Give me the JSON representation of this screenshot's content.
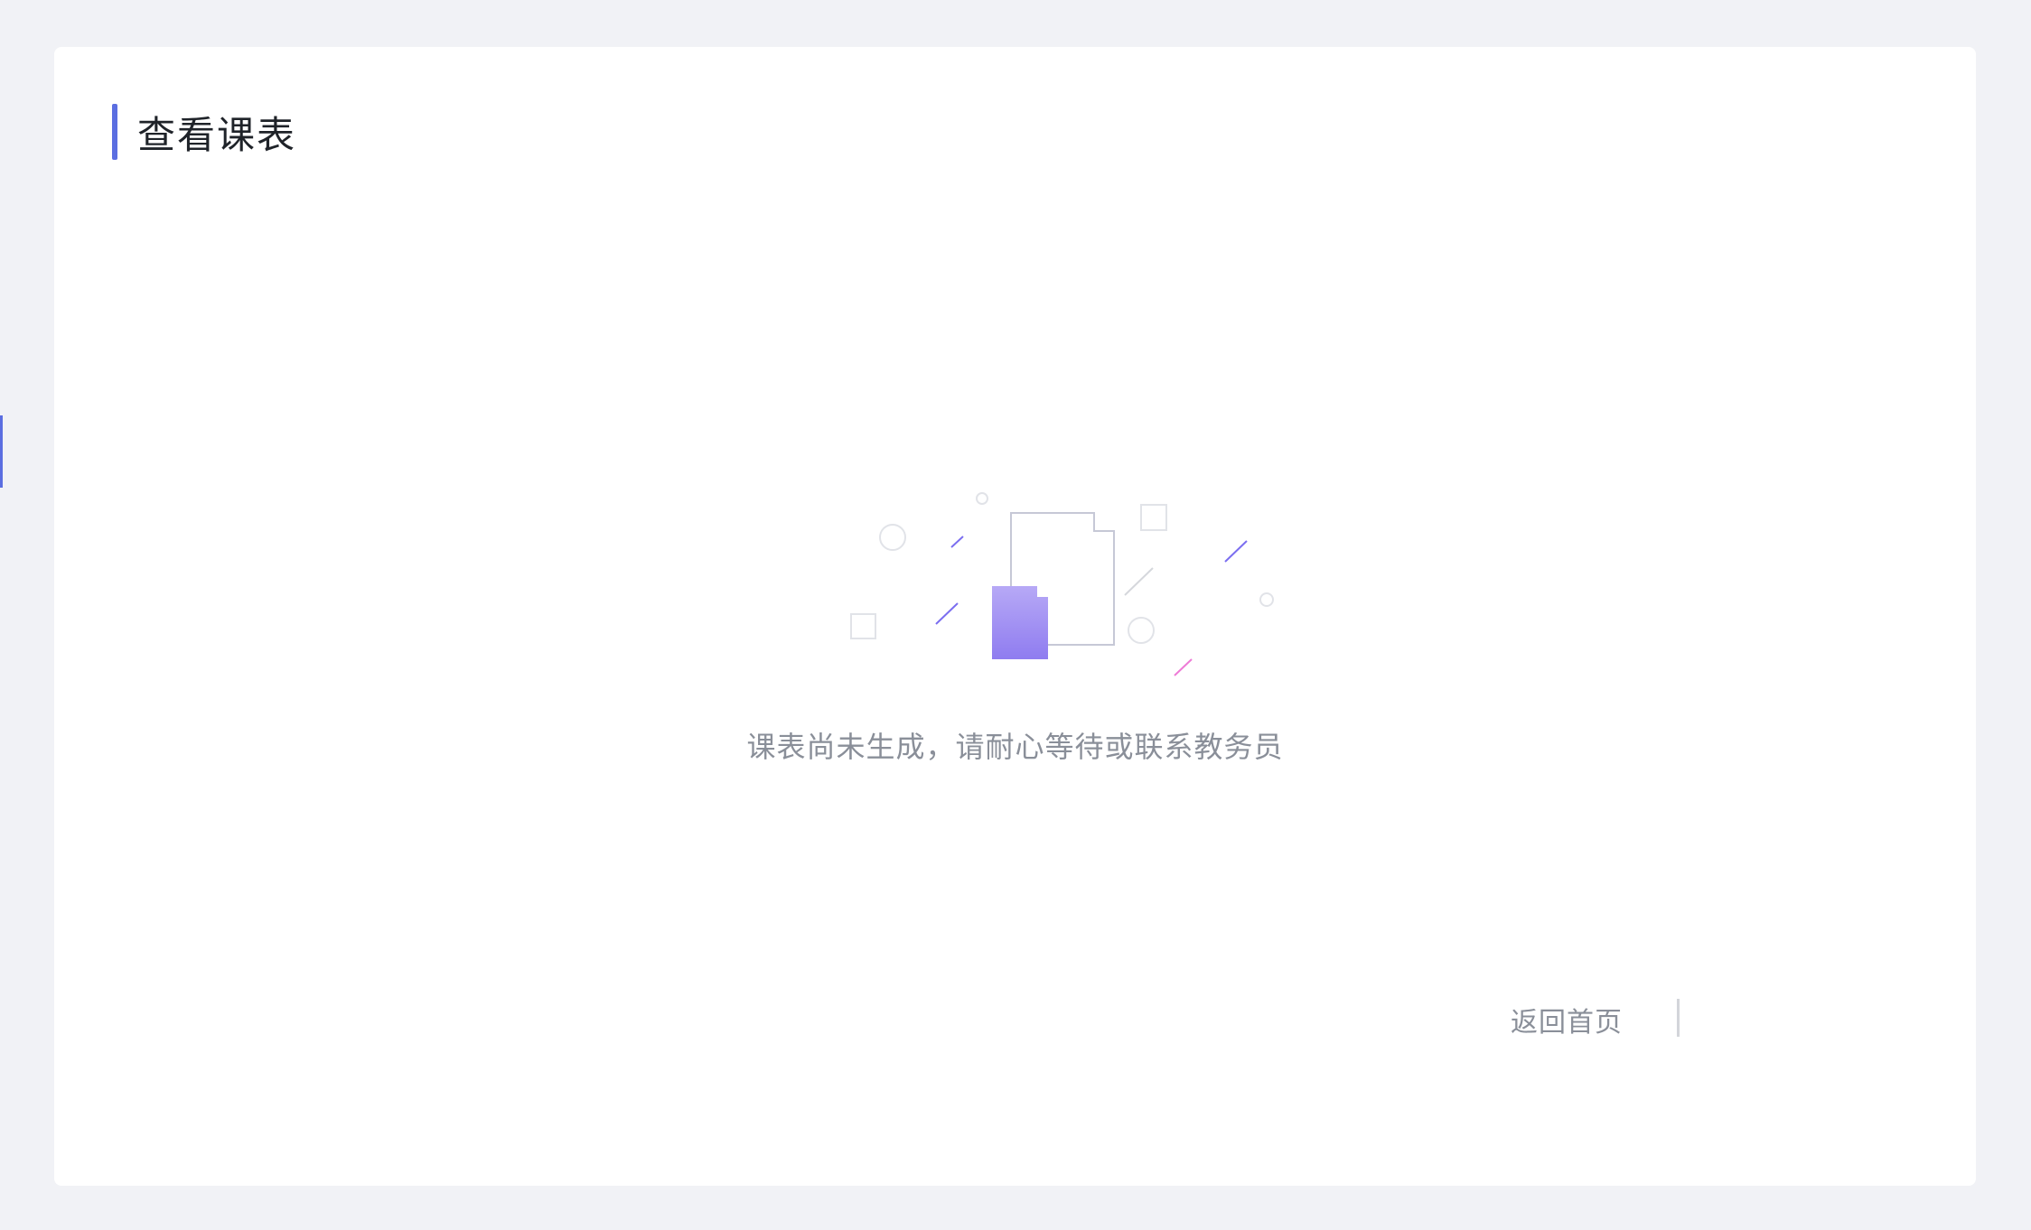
{
  "page": {
    "title": "查看课表"
  },
  "empty_state": {
    "icon": "empty-document-icon",
    "message": "课表尚未生成，请耐心等待或联系教务员"
  },
  "actions": {
    "back_home_label": "返回首页"
  },
  "colors": {
    "background": "#f1f2f6",
    "card": "#ffffff",
    "accent": "#5b6ee1",
    "illustration_fill": "#9d8ef2",
    "muted_text": "#8a8f99",
    "title_text": "#1f2329"
  }
}
